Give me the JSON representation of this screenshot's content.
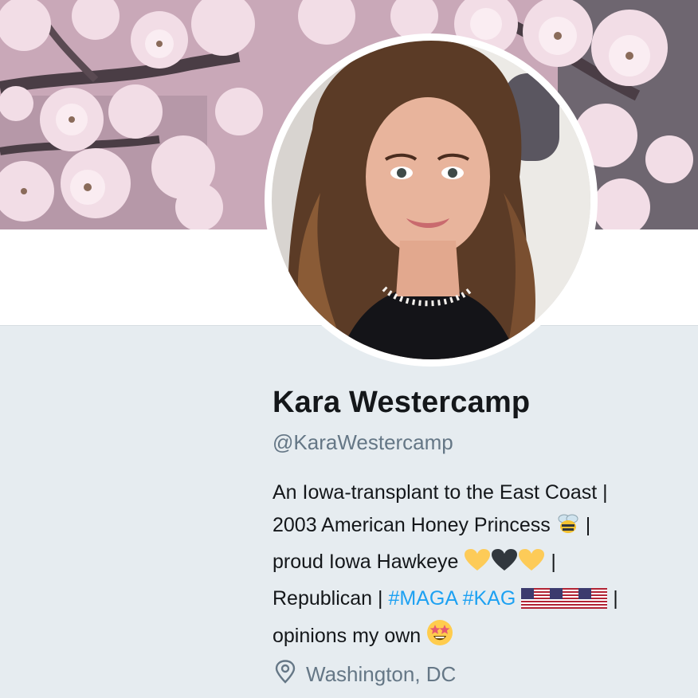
{
  "profile": {
    "name": "Kara Westercamp",
    "handle": "@KaraWestercamp",
    "bio": {
      "line1": "An Iowa-transplant to the East Coast |",
      "line2_text": "2003 American Honey Princess",
      "line2_sep": " |",
      "line3_text": "proud Iowa Hawkeye",
      "line3_sep": " |",
      "line4_prefix": "Republican | ",
      "hashtag1": "#MAGA",
      "hashtag2": "#KAG",
      "line4_sep": " |",
      "line5_text": "opinions my own"
    },
    "location": "Washington, DC"
  },
  "icons": {
    "location": "map-pin-icon",
    "bee": "honeybee-emoji",
    "heart_yellow": "yellow-heart-emoji",
    "heart_black": "black-heart-emoji",
    "flag": "us-flag-emoji",
    "star_struck": "star-struck-emoji"
  },
  "colors": {
    "background": "#e6ecf0",
    "text": "#14171a",
    "secondary_text": "#657786",
    "link": "#1da1f2"
  }
}
